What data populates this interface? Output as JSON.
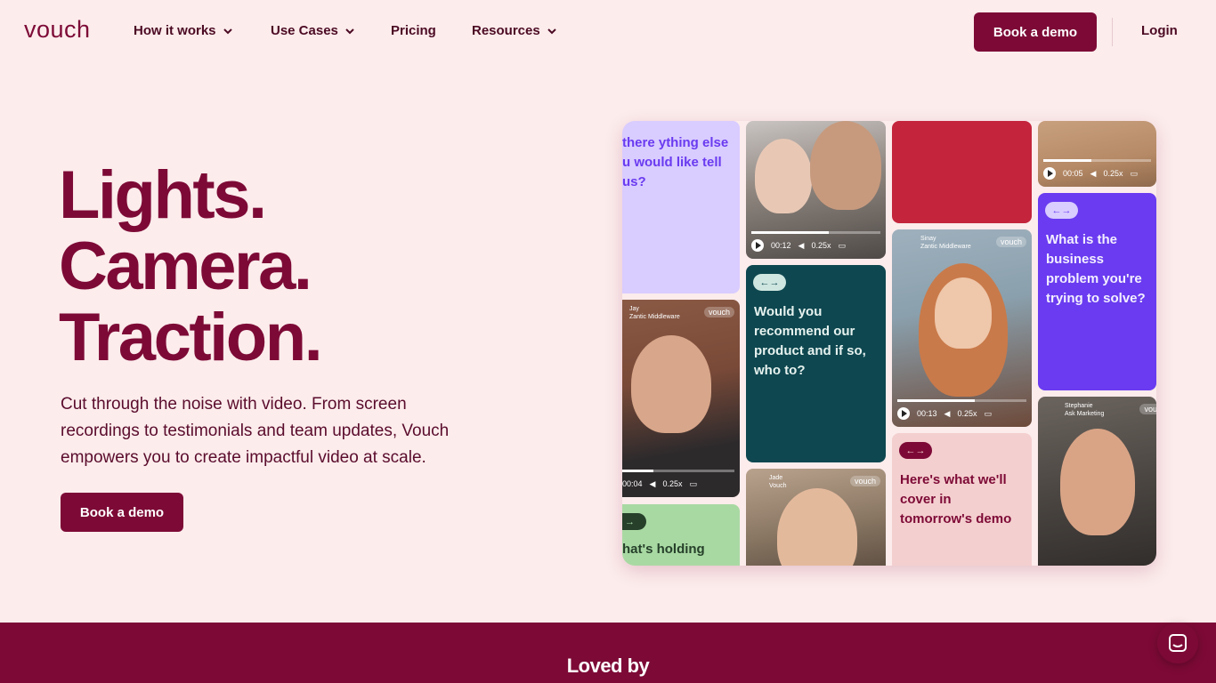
{
  "nav": {
    "logo": "vouch",
    "items": [
      {
        "label": "How it works",
        "has_menu": true
      },
      {
        "label": "Use Cases",
        "has_menu": true
      },
      {
        "label": "Pricing",
        "has_menu": false
      },
      {
        "label": "Resources",
        "has_menu": true
      }
    ],
    "cta": "Book a demo",
    "login": "Login"
  },
  "hero": {
    "line1": "Lights.",
    "line2": "Camera.",
    "line3": "Traction.",
    "subtext": "Cut through the noise with video. From screen recordings to testimonials and team updates, Vouch empowers you to create impactful video at scale.",
    "cta": "Book a demo"
  },
  "collage": {
    "q1": "there ything else u would like tell us?",
    "q2": "Would you recommend our product and if so, who to?",
    "q3": "What is the business problem you're trying to solve?",
    "q4": "Here's what we'll cover in tomorrow's demo",
    "q5": "hat's holding",
    "v1": {
      "time": "00:12",
      "speed": "0.25x"
    },
    "v2": {
      "time": "00:05",
      "speed": "0.25x"
    },
    "v3": {
      "name": "Sinay",
      "company": "Zantic Middleware",
      "brand": "vouch",
      "time": "00:13",
      "speed": "0.25x"
    },
    "v4": {
      "name": "Jay",
      "company": "Zantic Middleware",
      "brand": "vouch",
      "time": "00:04",
      "speed": "0.25x"
    },
    "v5": {
      "name": "Jade",
      "company": "Vouch",
      "brand": "vouch"
    },
    "v6": {
      "name": "Stephanie",
      "company": "Ask Marketing",
      "brand": "vou"
    }
  },
  "band": {
    "title": "Loved by"
  },
  "colors": {
    "brand": "#7d0a36",
    "background": "#fcecec",
    "lavender": "#d9ccff",
    "teal": "#0e4750",
    "red": "#c4253d",
    "purple": "#6a3bf0",
    "pink": "#f4cfcf",
    "green": "#a9d9a3"
  }
}
